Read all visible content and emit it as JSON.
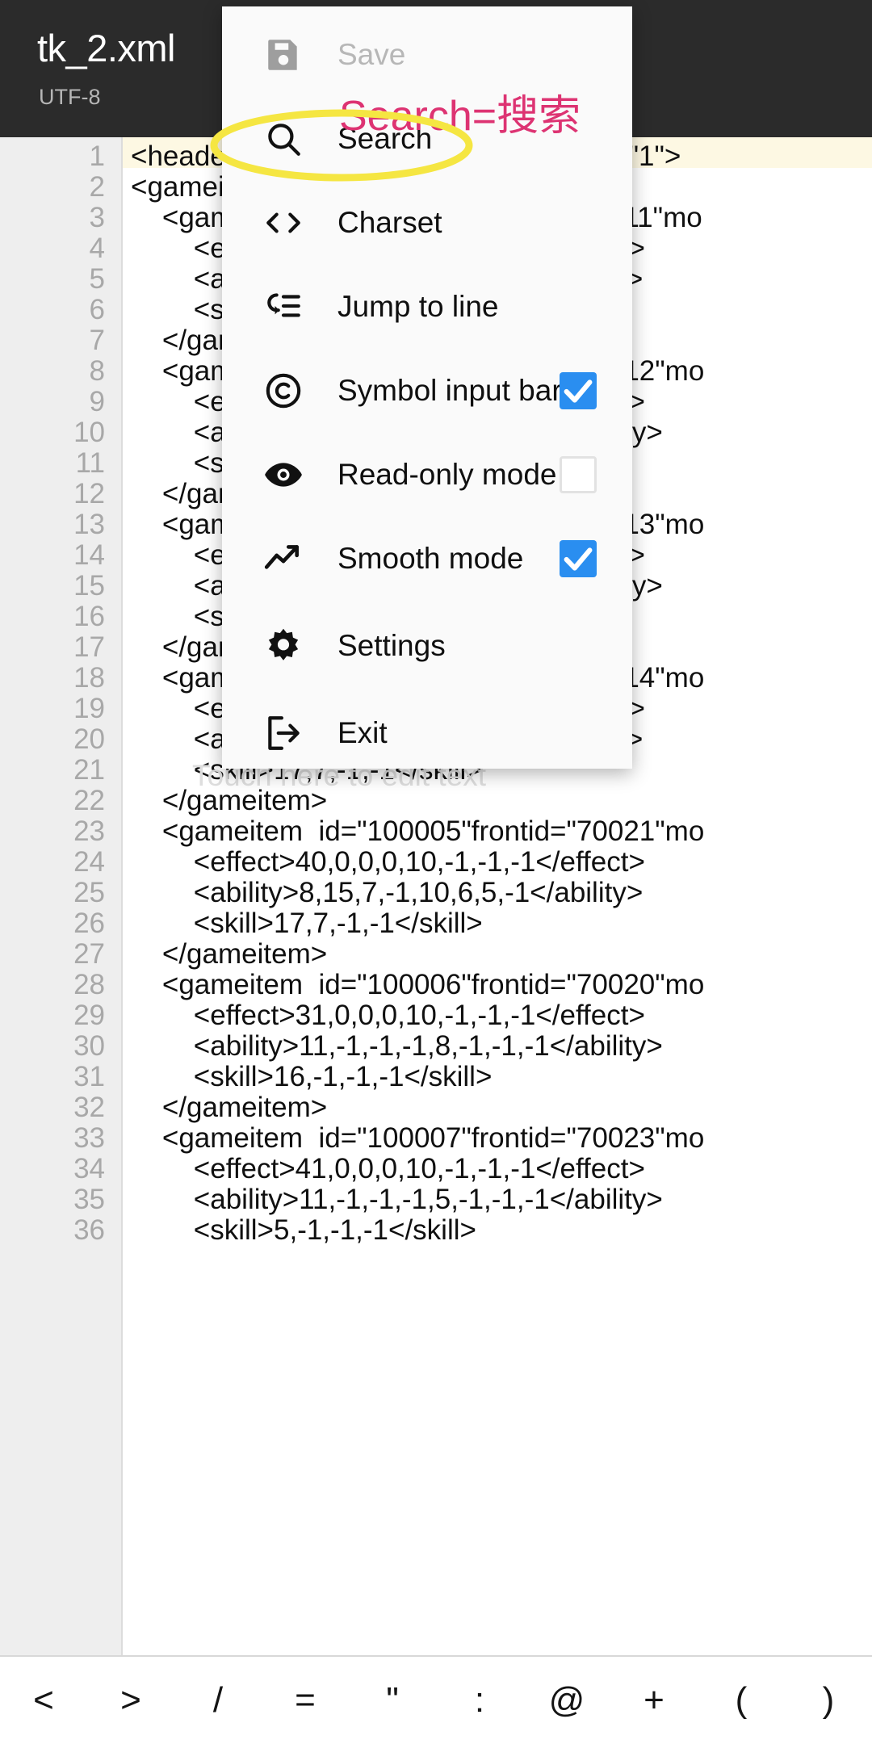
{
  "titlebar": {
    "filename": "tk_2.xml",
    "encoding": "UTF-8"
  },
  "editor": {
    "watermark": "Touch here to edit text",
    "lines": [
      {
        "num": "1",
        "text": "<header TYPE=\"gameitem\" VERSION=\"1\">"
      },
      {
        "num": "2",
        "text": "<gameitems>"
      },
      {
        "num": "3",
        "text": "    <gameitem  id=\"100001\"frontid=\"70011\"mo"
      },
      {
        "num": "4",
        "text": "        <effect>40,0,0,0,10,-1,-1,-1</effect>"
      },
      {
        "num": "5",
        "text": "        <ability>8,15,7,-1,10,6,5,-1</ability>"
      },
      {
        "num": "6",
        "text": "        <skill>17,7,-1,-1</skill>"
      },
      {
        "num": "7",
        "text": "    </gameitem>"
      },
      {
        "num": "8",
        "text": "    <gameitem  id=\"100002\"frontid=\"70012\"mo"
      },
      {
        "num": "9",
        "text": "        <effect>31,0,0,0,10,-1,-1,-1</effect>"
      },
      {
        "num": "10",
        "text": "        <ability>11,-1,-1,-1,8,-1,-1,-1</ability>"
      },
      {
        "num": "11",
        "text": "        <skill>16,-1,-1,-1</skill>"
      },
      {
        "num": "12",
        "text": "    </gameitem>"
      },
      {
        "num": "13",
        "text": "    <gameitem  id=\"100003\"frontid=\"70013\"mo"
      },
      {
        "num": "14",
        "text": "        <effect>41,0,0,0,10,-1,-1,-1</effect>"
      },
      {
        "num": "15",
        "text": "        <ability>11,-1,-1,-1,5,-1,-1,-1</ability>"
      },
      {
        "num": "16",
        "text": "        <skill>5,-1,-1,-1</skill>"
      },
      {
        "num": "17",
        "text": "    </gameitem>"
      },
      {
        "num": "18",
        "text": "    <gameitem  id=\"100004\"frontid=\"70014\"mo"
      },
      {
        "num": "19",
        "text": "        <effect>40,0,0,0,10,-1,-1,-1</effect>"
      },
      {
        "num": "20",
        "text": "        <ability>8,15,7,-1,10,6,5,-1</ability>"
      },
      {
        "num": "21",
        "text": "        <skill>17,7,-1,-1</skill>"
      },
      {
        "num": "22",
        "text": "    </gameitem>"
      },
      {
        "num": "23",
        "text": "    <gameitem  id=\"100005\"frontid=\"70021\"mo"
      },
      {
        "num": "24",
        "text": "        <effect>40,0,0,0,10,-1,-1,-1</effect>"
      },
      {
        "num": "25",
        "text": "        <ability>8,15,7,-1,10,6,5,-1</ability>"
      },
      {
        "num": "26",
        "text": "        <skill>17,7,-1,-1</skill>"
      },
      {
        "num": "27",
        "text": "    </gameitem>"
      },
      {
        "num": "28",
        "text": "    <gameitem  id=\"100006\"frontid=\"70020\"mo"
      },
      {
        "num": "29",
        "text": "        <effect>31,0,0,0,10,-1,-1,-1</effect>"
      },
      {
        "num": "30",
        "text": "        <ability>11,-1,-1,-1,8,-1,-1,-1</ability>"
      },
      {
        "num": "31",
        "text": "        <skill>16,-1,-1,-1</skill>"
      },
      {
        "num": "32",
        "text": "    </gameitem>"
      },
      {
        "num": "33",
        "text": "    <gameitem  id=\"100007\"frontid=\"70023\"mo"
      },
      {
        "num": "34",
        "text": "        <effect>41,0,0,0,10,-1,-1,-1</effect>"
      },
      {
        "num": "35",
        "text": "        <ability>11,-1,-1,-1,5,-1,-1,-1</ability>"
      },
      {
        "num": "36",
        "text": "        <skill>5,-1,-1,-1</skill>"
      }
    ]
  },
  "menu": {
    "items": [
      {
        "label": "Save",
        "icon": "save-icon",
        "disabled": true,
        "checkbox": null
      },
      {
        "label": "Search",
        "icon": "search-icon",
        "disabled": false,
        "checkbox": null
      },
      {
        "label": "Charset",
        "icon": "code-brackets-icon",
        "disabled": false,
        "checkbox": null
      },
      {
        "label": "Jump to line",
        "icon": "jump-to-line-icon",
        "disabled": false,
        "checkbox": null
      },
      {
        "label": "Symbol input bar",
        "icon": "copyright-icon",
        "disabled": false,
        "checkbox": "checked"
      },
      {
        "label": "Read-only mode",
        "icon": "eye-icon",
        "disabled": false,
        "checkbox": "unchecked"
      },
      {
        "label": "Smooth mode",
        "icon": "trending-up-icon",
        "disabled": false,
        "checkbox": "checked"
      },
      {
        "label": "Settings",
        "icon": "gear-icon",
        "disabled": false,
        "checkbox": null
      },
      {
        "label": "Exit",
        "icon": "exit-icon",
        "disabled": false,
        "checkbox": null
      }
    ]
  },
  "annotation": {
    "text": "Search=搜索",
    "text_color": "#dd3372",
    "highlight_color": "#f5e642",
    "highlight_target": "Search"
  },
  "symbolbar": {
    "symbols": [
      "<",
      ">",
      "/",
      "=",
      "\"",
      ":",
      "@",
      "+",
      "(",
      ")"
    ]
  },
  "colors": {
    "titlebar_bg": "#2b2b2b",
    "menu_bg": "#fafafa",
    "gutter_bg": "#eeeeee",
    "checkbox_on": "#2a8ef0",
    "cursor_line": "#fdf8e3"
  }
}
